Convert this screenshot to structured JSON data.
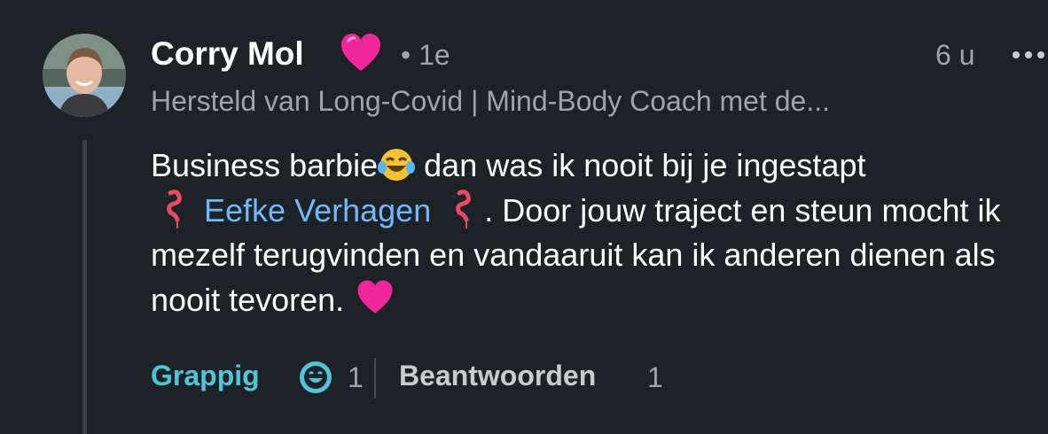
{
  "comment": {
    "author": {
      "name": "Corry Mol",
      "degree": "• 1e",
      "headline": "Hersteld van Long-Covid | Mind-Body Coach met de..."
    },
    "time": "6 u",
    "body": {
      "part1": "Business barbie",
      "part2": " dan was ik nooit bij je ingestapt",
      "mention": "Eefke Verhagen",
      "part3": ". Door jouw traject en steun mocht ik mezelf terugvinden en vandaaruit kan ik anderen dienen als nooit tevoren."
    },
    "reactions": {
      "label": "Grappig",
      "count": "1"
    },
    "reply": {
      "label": "Beantwoorden",
      "count": "1"
    }
  },
  "colors": {
    "background": "#1d2226",
    "mention": "#71b7fb",
    "reaction_label": "#4fc6d8",
    "muted_text": "#a0a4a8"
  },
  "icons": [
    "pink-heart-icon",
    "laughing-tears-emoji-icon",
    "flamingo-emoji-icon",
    "funny-reaction-icon",
    "more-options-icon"
  ]
}
